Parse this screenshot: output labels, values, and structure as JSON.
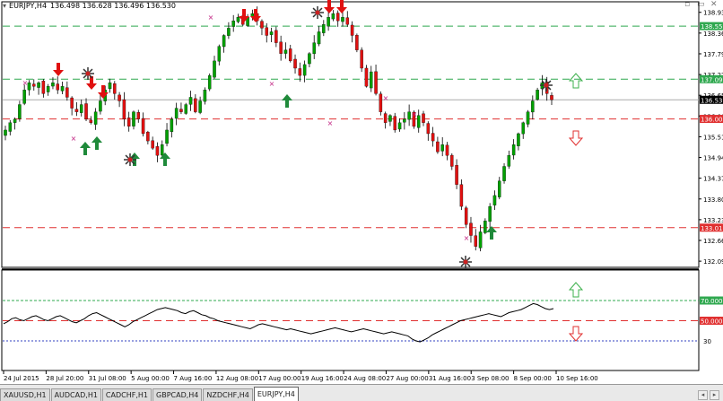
{
  "window": {
    "symbol_label": "EURJPY,H4",
    "ohlc": "136.498 136.628 136.496 136.530",
    "collapse_icon": "triangle-down-icon",
    "minimize_icon": "minimize-icon",
    "close_icon": "close-icon"
  },
  "price_axis": {
    "ticks": [
      "138.935",
      "138.365",
      "137.795",
      "137.225",
      "136.655",
      "136.085",
      "135.515",
      "134.945",
      "134.375",
      "133.805",
      "133.235",
      "132.665",
      "132.095"
    ],
    "labels": [
      {
        "text": "138.556",
        "color": "#2fa84f",
        "value": 138.556
      },
      {
        "text": "137.097",
        "color": "#2fa84f",
        "value": 137.097
      },
      {
        "text": "136.530",
        "color": "#000000",
        "value": 136.53
      },
      {
        "text": "136.005",
        "color": "#e03030",
        "value": 136.005
      },
      {
        "text": "133.016",
        "color": "#e03030",
        "value": 133.016
      }
    ]
  },
  "time_axis": {
    "labels": [
      "24 Jul 2015",
      "28 Jul 20:00",
      "31 Jul 08:00",
      "5 Aug 00:00",
      "7 Aug 16:00",
      "12 Aug 08:00",
      "17 Aug 00:00",
      "19 Aug 16:00",
      "24 Aug 08:00",
      "27 Aug 00:00",
      "31 Aug 16:00",
      "3 Sep 08:00",
      "8 Sep 00:00",
      "10 Sep 16:00"
    ]
  },
  "indicator_axis": {
    "labels": [
      {
        "text": "70.0000",
        "color": "#2fa84f",
        "value": 70
      },
      {
        "text": "50.0000",
        "color": "#e03030",
        "value": 50
      }
    ],
    "ticks": [
      "30"
    ]
  },
  "tabs": [
    {
      "label": "XAUUSD,H1",
      "active": false
    },
    {
      "label": "AUDCAD,H1",
      "active": false
    },
    {
      "label": "CADCHF,H1",
      "active": false
    },
    {
      "label": "GBPCAD,H4",
      "active": false
    },
    {
      "label": "NZDCHF,H4",
      "active": false
    },
    {
      "label": "EURJPY,H4",
      "active": true
    }
  ],
  "tab_nav": [
    "tab-scroll-left-icon",
    "tab-scroll-right-icon"
  ],
  "colors": {
    "bull": "#00a000",
    "bear": "#e01010",
    "wick": "#000000",
    "level_green": "#2fa84f",
    "level_red": "#e03030",
    "arrow_up_green": "#1f8a3a",
    "arrow_down_red": "#e01010",
    "star": "#333333",
    "indicator_line": "#000000",
    "level_30": "#3040c0"
  },
  "chart_data": {
    "type": "candlestick",
    "symbol": "EURJPY",
    "timeframe": "H4",
    "ylim": [
      131.95,
      139.2
    ],
    "levels": [
      138.556,
      137.097,
      136.53,
      136.005,
      133.016
    ],
    "candles_close_path": [
      135.7,
      135.9,
      136.0,
      136.4,
      136.8,
      137.0,
      136.9,
      137.0,
      136.7,
      136.9,
      137.0,
      136.8,
      136.9,
      136.6,
      136.3,
      136.2,
      136.4,
      136.0,
      135.9,
      136.2,
      136.5,
      136.8,
      137.0,
      136.7,
      136.5,
      136.0,
      135.8,
      136.2,
      136.0,
      135.6,
      135.4,
      135.2,
      135.0,
      135.3,
      135.7,
      136.0,
      136.3,
      136.2,
      136.4,
      136.6,
      136.2,
      136.5,
      136.8,
      137.2,
      137.6,
      138.0,
      138.3,
      138.5,
      138.7,
      138.8,
      138.6,
      138.8,
      138.9,
      138.7,
      138.5,
      138.3,
      138.4,
      138.1,
      137.8,
      137.9,
      137.6,
      137.4,
      137.2,
      137.5,
      137.8,
      138.1,
      138.4,
      138.6,
      138.8,
      138.9,
      138.7,
      138.8,
      138.6,
      138.3,
      137.9,
      137.4,
      136.9,
      137.3,
      136.7,
      136.2,
      135.9,
      136.1,
      135.7,
      135.9,
      136.0,
      136.2,
      135.8,
      136.1,
      135.9,
      135.6,
      135.4,
      135.1,
      135.3,
      135.0,
      134.7,
      134.2,
      133.6,
      133.1,
      132.8,
      132.5,
      132.9,
      133.2,
      133.6,
      133.9,
      134.3,
      134.7,
      135.0,
      135.3,
      135.6,
      135.9,
      136.2,
      136.5,
      136.8,
      137.0,
      136.7,
      136.53
    ],
    "indicator_series": [
      47,
      49,
      52,
      53,
      51,
      50,
      52,
      54,
      55,
      53,
      51,
      50,
      52,
      54,
      55,
      53,
      51,
      49,
      48,
      50,
      52,
      55,
      57,
      58,
      56,
      54,
      52,
      50,
      48,
      46,
      44,
      46,
      49,
      51,
      53,
      55,
      57,
      59,
      61,
      62,
      63,
      62,
      61,
      60,
      58,
      57,
      59,
      60,
      58,
      56,
      55,
      53,
      52,
      50,
      49,
      48,
      47,
      46,
      45,
      44,
      43,
      42,
      44,
      46,
      47,
      46,
      45,
      44,
      43,
      42,
      41,
      42,
      41,
      40,
      39,
      38,
      37,
      38,
      39,
      40,
      41,
      42,
      43,
      42,
      41,
      40,
      39,
      40,
      41,
      42,
      41,
      40,
      39,
      38,
      37,
      38,
      39,
      38,
      37,
      36,
      35,
      32,
      30,
      29,
      31,
      33,
      36,
      38,
      40,
      42,
      44,
      46,
      48,
      50,
      51,
      52,
      53,
      54,
      55,
      56,
      57,
      56,
      55,
      54,
      56,
      58,
      59,
      60,
      61,
      63,
      65,
      67,
      66,
      64,
      62,
      61,
      62
    ]
  }
}
